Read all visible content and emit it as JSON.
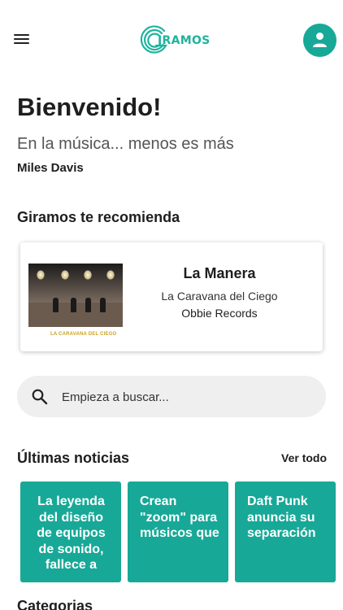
{
  "header": {
    "logo_text": "IRAMOS",
    "menu_icon": "hamburger-menu-icon",
    "profile_icon": "user-icon",
    "accent_color": "#18a897"
  },
  "welcome": {
    "title": "Bienvenido!",
    "quote": "En la música... menos es más",
    "author": "Miles Davis"
  },
  "recommendation": {
    "heading": "Giramos te recomienda",
    "cover_caption": "LA CARAVANA DEL CIEGO",
    "title": "La Manera",
    "artist": "La Caravana del Ciego",
    "label": "Obbie Records"
  },
  "search": {
    "placeholder": "Empieza a buscar...",
    "icon": "search-icon"
  },
  "news": {
    "heading": "Últimas noticias",
    "see_all": "Ver todo",
    "items": [
      {
        "title": "La leyenda del diseño de equipos de sonido, fallece a"
      },
      {
        "title": "Crean \"zoom\" para músicos que"
      },
      {
        "title": "Daft Punk anuncia su separación"
      }
    ]
  },
  "categories": {
    "heading": "Categorias"
  }
}
